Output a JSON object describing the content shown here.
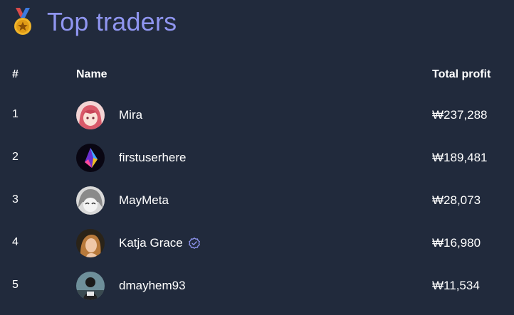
{
  "header": {
    "title": "Top traders",
    "icon": "medal-icon"
  },
  "columns": {
    "rank": "#",
    "name": "Name",
    "profit": "Total profit"
  },
  "rows": [
    {
      "rank": "1",
      "name": "Mira",
      "profit": "₩237,288",
      "verified": false
    },
    {
      "rank": "2",
      "name": "firstuserhere",
      "profit": "₩189,481",
      "verified": false
    },
    {
      "rank": "3",
      "name": "MayMeta",
      "profit": "₩28,073",
      "verified": false
    },
    {
      "rank": "4",
      "name": "Katja Grace",
      "profit": "₩16,980",
      "verified": true
    },
    {
      "rank": "5",
      "name": "dmayhem93",
      "profit": "₩11,534",
      "verified": false
    }
  ],
  "colors": {
    "background": "#212a3c",
    "title": "#8f95f0",
    "verified": "#8f95f0"
  }
}
